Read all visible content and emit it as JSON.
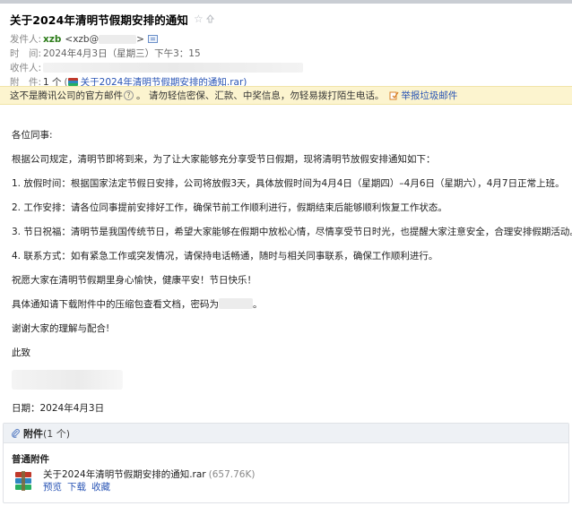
{
  "header": {
    "subject": "关于2024年清明节假期安排的通知",
    "from_label": "发件人:",
    "from_name": "xzb",
    "from_email_prefix": "<xzb@",
    "from_email_suffix": ">",
    "time_label": "时　间:",
    "time_value": "2024年4月3日（星期三）下午3：15",
    "to_label": "收件人:",
    "attach_label": "附　件:",
    "attach_count": "1 个",
    "attach_link": "关于2024年清明节假期安排的通知.rar)",
    "attach_paren_open": "("
  },
  "notice": {
    "text": "这不是腾讯公司的官方邮件",
    "qmark": "?",
    "warning": "。 请勿轻信密保、汇款、中奖信息，勿轻易拨打陌生电话。",
    "report": "举报垃圾邮件"
  },
  "body": {
    "greeting": "各位同事:",
    "intro": "根据公司规定，清明节即将到来，为了让大家能够充分享受节日假期，现将清明节放假安排通知如下：",
    "item1": "1. 放假时间：根据国家法定节假日安排，公司将放假3天，具体放假时间为4月4日（星期四）–4月6日（星期六），4月7日正常上班。",
    "item2": "2. 工作安排：请各位同事提前安排好工作，确保节前工作顺利进行，假期结束后能够顺利恢复工作状态。",
    "item3": "3. 节日祝福：清明节是我国传统节日，希望大家能够在假期中放松心情，尽情享受节日时光，也提醒大家注意安全，合理安排假期活动。",
    "item4": "4. 联系方式：如有紧急工作或突发情况，请保持电话畅通，随时与相关同事联系，确保工作顺利进行。",
    "wish": "祝愿大家在清明节假期里身心愉快，健康平安！节日快乐！",
    "download_prefix": "具体通知请下载附件中的压缩包查看文档，密码为",
    "download_suffix": "。",
    "thanks": "谢谢大家的理解与配合!",
    "closing": "此致",
    "date": "日期：2024年4月3日"
  },
  "attachments": {
    "title": "附件",
    "count": "(1 个)",
    "section": "普通附件",
    "file_name": "关于2024年清明节假期安排的通知.rar",
    "file_size": "(657.76K)",
    "actions": [
      "预览",
      "下载",
      "收藏"
    ]
  },
  "colors": {
    "sender_green": "#2e7d1b",
    "link_blue": "#2a55b5",
    "notice_bg": "#fcf4cf"
  }
}
